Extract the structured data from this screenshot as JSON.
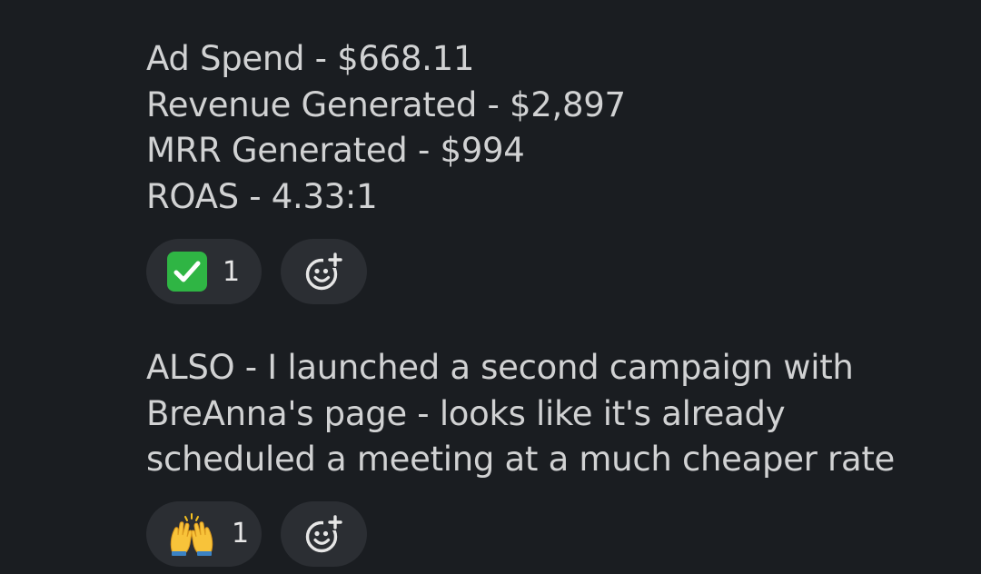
{
  "messages": [
    {
      "lines": [
        "Ad Spend - $668.11",
        "Revenue Generated - $2,897",
        "MRR Generated - $994",
        "ROAS - 4.33:1"
      ],
      "reaction": {
        "emoji": "check-mark-button",
        "count": "1"
      }
    },
    {
      "lines": [
        "ALSO - I launched a second campaign with",
        "BreAnna's page - looks like it's already",
        "scheduled a meeting at a much cheaper rate"
      ],
      "reaction": {
        "emoji": "raising-hands",
        "count": "1"
      }
    }
  ],
  "colors": {
    "background": "#1a1d21",
    "text": "#d1d2d3",
    "pill": "#2b2e33",
    "check_green": "#2fb544"
  }
}
